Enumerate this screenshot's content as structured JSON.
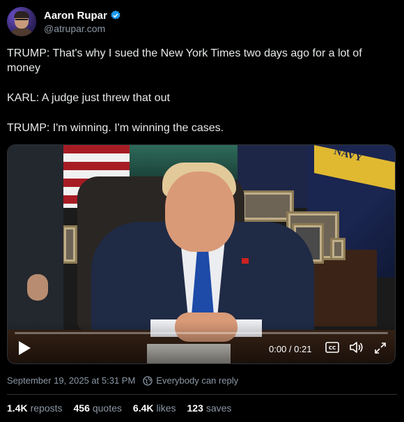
{
  "author": {
    "display_name": "Aaron Rupar",
    "handle": "@atrupar.com",
    "verified": true,
    "avatar_icon": "avatar-photo"
  },
  "post": {
    "lines": [
      "TRUMP: That's why I sued the New York Times two days ago for a lot of money",
      "KARL: A judge just threw that out",
      "TRUMP: I'm winning. I'm winning the cases."
    ]
  },
  "video": {
    "time": "0:00 / 0:21",
    "progress": 0,
    "banner_text": "NAVY",
    "icons": {
      "play": "play-icon",
      "captions": "captions-icon",
      "volume": "volume-icon",
      "fullscreen": "fullscreen-icon"
    }
  },
  "meta": {
    "timestamp": "September 19, 2025 at 5:31 PM",
    "reply_setting": "Everybody can reply"
  },
  "stats": [
    {
      "value": "1.4K",
      "label": "reposts"
    },
    {
      "value": "456",
      "label": "quotes"
    },
    {
      "value": "6.4K",
      "label": "likes"
    },
    {
      "value": "123",
      "label": "saves"
    }
  ],
  "colors": {
    "background": "#000000",
    "text": "#e7e9ea",
    "muted": "#8b98a5",
    "verified_badge": "#1d9bf0"
  }
}
